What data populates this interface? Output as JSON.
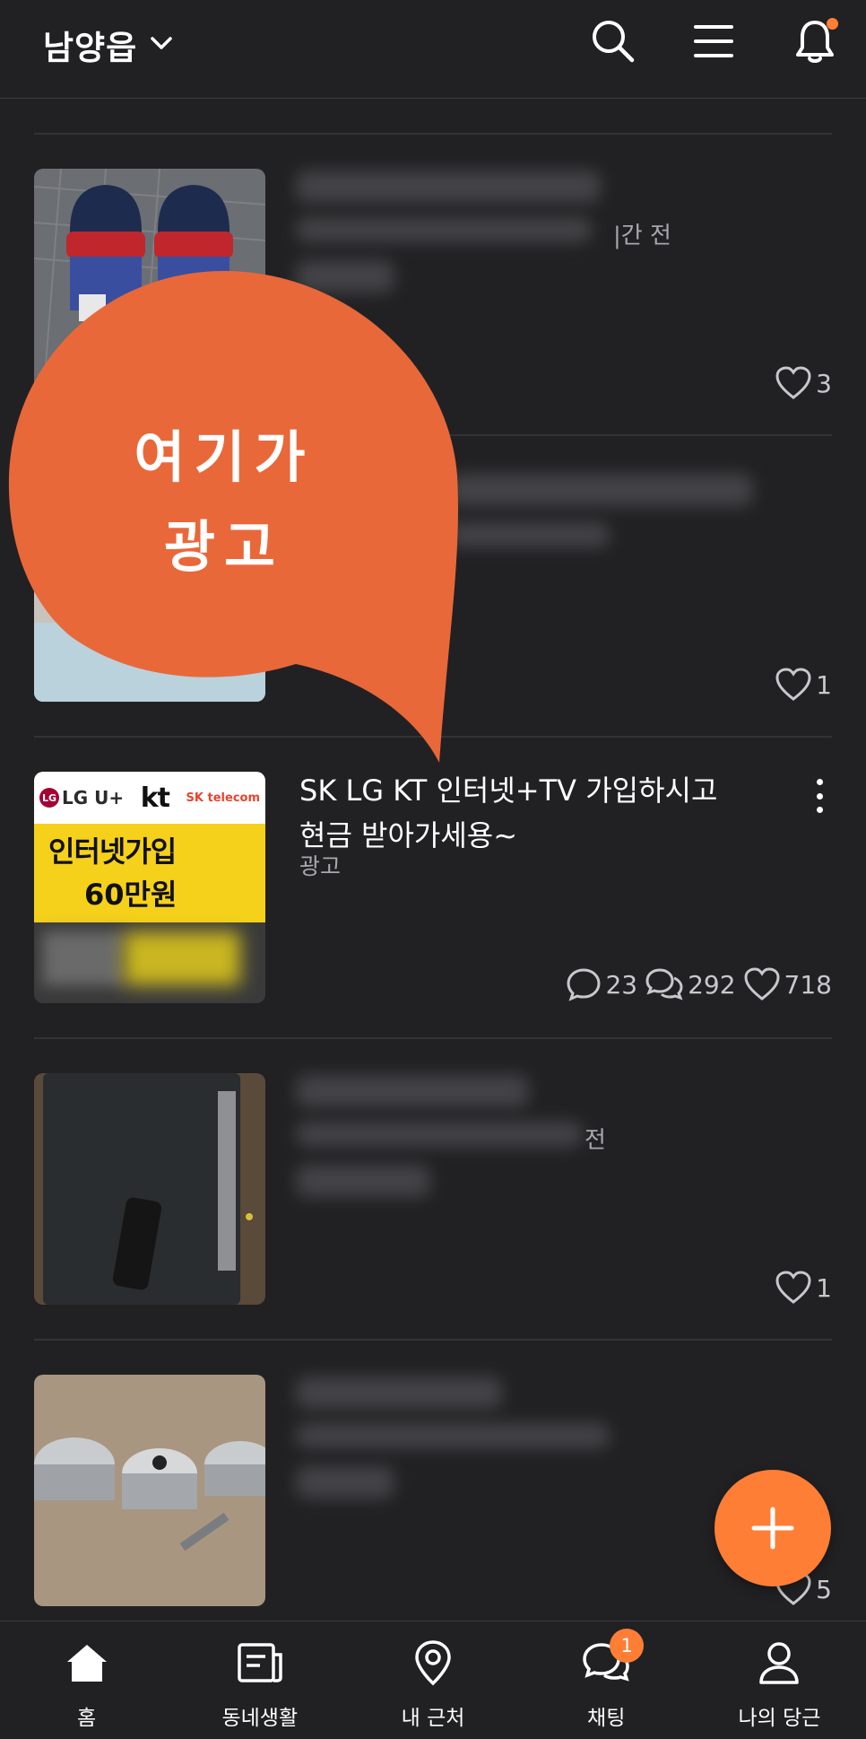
{
  "header": {
    "location": "남양읍",
    "icons": [
      "chevron-down-icon",
      "search-icon",
      "menu-icon",
      "bell-icon"
    ],
    "notification_dot": true
  },
  "items": [
    {
      "time_suffix": "|간 전",
      "likes": "3"
    },
    {
      "likes": "1"
    },
    {
      "ad_title_line1": "SK LG KT 인터넷+TV 가입하시고",
      "ad_title_line2": "현금 받아가세용~",
      "ad_label": "광고",
      "comments": "23",
      "chats": "292",
      "likes": "718",
      "thumb": {
        "logo_lg": "LG U+",
        "logo_kt": "kt",
        "logo_sk": "SK telecom",
        "line1": "인터넷가입",
        "line2": "60만원"
      }
    },
    {
      "time_suffix": "전",
      "likes": "1"
    },
    {
      "likes": "5"
    }
  ],
  "annotation": {
    "line1": "여기가",
    "line2": "광고"
  },
  "fab": {
    "icon": "plus-icon"
  },
  "bottom_nav": [
    {
      "label": "홈",
      "icon": "home-icon"
    },
    {
      "label": "동네생활",
      "icon": "newspaper-icon"
    },
    {
      "label": "내 근처",
      "icon": "location-pin-icon"
    },
    {
      "label": "채팅",
      "icon": "chat-icon",
      "badge": "1"
    },
    {
      "label": "나의 당근",
      "icon": "person-icon"
    }
  ],
  "colors": {
    "background": "#212123",
    "accent": "#ff7e36",
    "bubble": "#e8683a",
    "text": "#ffffff",
    "muted": "#a8a8ad"
  }
}
